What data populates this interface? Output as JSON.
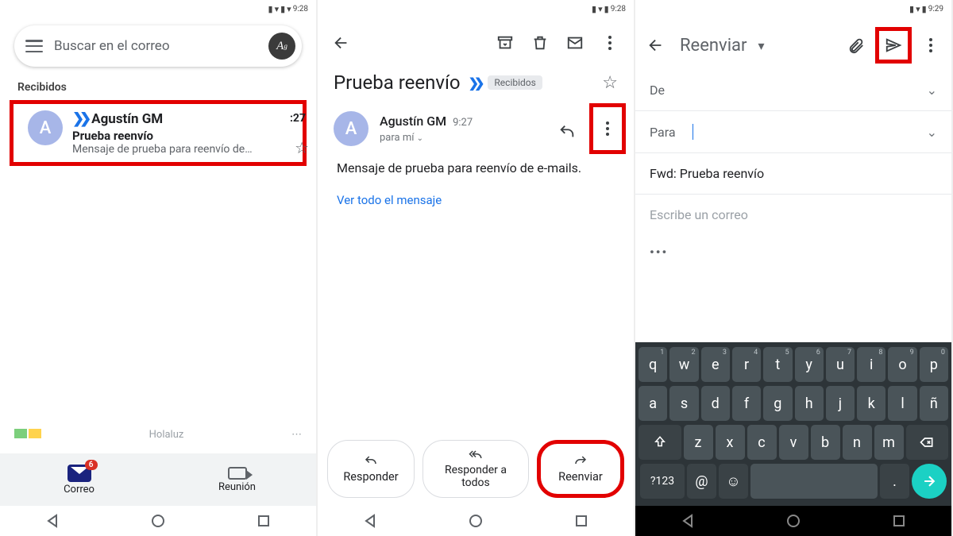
{
  "status": {
    "time": "9:28",
    "time_alt": "9:29"
  },
  "panel1": {
    "search_placeholder": "Buscar en el correo",
    "avatar_letter": "A",
    "section": "Recibidos",
    "item": {
      "avatar": "A",
      "sender": "Agustín GM",
      "time": ":27",
      "subject": "Prueba reenvío",
      "snippet": "Mensaje de prueba para reenvío de…"
    },
    "prev_sender": "Holaluz",
    "bottom": {
      "mail": "Correo",
      "badge": "6",
      "meet": "Reunión"
    }
  },
  "panel2": {
    "subject": "Prueba reenvío",
    "chip": "Recibidos",
    "sender": "Agustín GM",
    "time": "9:27",
    "to_me": "para mí",
    "body": "Mensaje de prueba para reenvío de e-mails.",
    "see_all": "Ver todo el mensaje",
    "actions": {
      "reply": "Responder",
      "reply_all": "Responder a todos",
      "forward": "Reenviar"
    }
  },
  "panel3": {
    "mode": "Reenviar",
    "from": "De",
    "to": "Para",
    "subject": "Fwd: Prueba reenvío",
    "body_placeholder": "Escribe un correo",
    "keyboard": {
      "row1": [
        [
          "q",
          "1"
        ],
        [
          "w",
          "2"
        ],
        [
          "e",
          "3"
        ],
        [
          "r",
          "4"
        ],
        [
          "t",
          "5"
        ],
        [
          "y",
          "6"
        ],
        [
          "u",
          "7"
        ],
        [
          "i",
          "8"
        ],
        [
          "o",
          "9"
        ],
        [
          "p",
          "0"
        ]
      ],
      "row2": [
        "a",
        "s",
        "d",
        "f",
        "g",
        "h",
        "j",
        "k",
        "l",
        "ñ"
      ],
      "row3": [
        "z",
        "x",
        "c",
        "v",
        "b",
        "n",
        "m"
      ],
      "sym": "?123"
    }
  }
}
